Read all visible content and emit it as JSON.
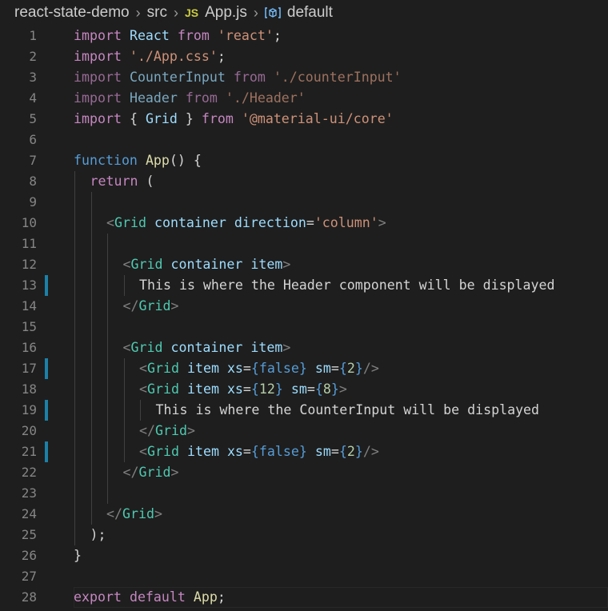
{
  "breadcrumb": {
    "folder": "react-state-demo",
    "subfolder": "src",
    "file_badge": "JS",
    "file": "App.js",
    "symbol": "default"
  },
  "lines": [
    {
      "n": "1",
      "indent": 0,
      "mark": false,
      "tokens": [
        [
          "kc",
          "import"
        ],
        [
          "txt",
          " "
        ],
        [
          "attr",
          "React"
        ],
        [
          "txt",
          " "
        ],
        [
          "kc",
          "from"
        ],
        [
          "txt",
          " "
        ],
        [
          "str",
          "'react'"
        ],
        [
          "txt",
          ";"
        ]
      ]
    },
    {
      "n": "2",
      "indent": 0,
      "mark": false,
      "tokens": [
        [
          "kc",
          "import"
        ],
        [
          "txt",
          " "
        ],
        [
          "str",
          "'./App.css'"
        ],
        [
          "txt",
          ";"
        ]
      ]
    },
    {
      "n": "3",
      "indent": 0,
      "mark": false,
      "dim": true,
      "tokens": [
        [
          "kc",
          "import"
        ],
        [
          "txt",
          " "
        ],
        [
          "attr",
          "CounterInput"
        ],
        [
          "txt",
          " "
        ],
        [
          "kc",
          "from"
        ],
        [
          "txt",
          " "
        ],
        [
          "str",
          "'./counterInput'"
        ]
      ]
    },
    {
      "n": "4",
      "indent": 0,
      "mark": false,
      "dim": true,
      "tokens": [
        [
          "kc",
          "import"
        ],
        [
          "txt",
          " "
        ],
        [
          "attr",
          "Header"
        ],
        [
          "txt",
          " "
        ],
        [
          "kc",
          "from"
        ],
        [
          "txt",
          " "
        ],
        [
          "str",
          "'./Header'"
        ]
      ]
    },
    {
      "n": "5",
      "indent": 0,
      "mark": false,
      "tokens": [
        [
          "kc",
          "import"
        ],
        [
          "txt",
          " { "
        ],
        [
          "attr",
          "Grid"
        ],
        [
          "txt",
          " } "
        ],
        [
          "kc",
          "from"
        ],
        [
          "txt",
          " "
        ],
        [
          "str",
          "'@material-ui/core'"
        ]
      ]
    },
    {
      "n": "6",
      "indent": 0,
      "mark": false,
      "tokens": []
    },
    {
      "n": "7",
      "indent": 0,
      "mark": false,
      "tokens": [
        [
          "kw",
          "function"
        ],
        [
          "txt",
          " "
        ],
        [
          "fn",
          "App"
        ],
        [
          "txt",
          "() {"
        ]
      ]
    },
    {
      "n": "8",
      "indent": 1,
      "mark": false,
      "tokens": [
        [
          "kc",
          "return"
        ],
        [
          "txt",
          " ("
        ]
      ]
    },
    {
      "n": "9",
      "indent": 2,
      "mark": false,
      "tokens": []
    },
    {
      "n": "10",
      "indent": 2,
      "mark": false,
      "tokens": [
        [
          "tag",
          "<"
        ],
        [
          "type",
          "Grid"
        ],
        [
          "txt",
          " "
        ],
        [
          "attr",
          "container"
        ],
        [
          "txt",
          " "
        ],
        [
          "attr",
          "direction"
        ],
        [
          "txt",
          "="
        ],
        [
          "str",
          "'column'"
        ],
        [
          "tag",
          ">"
        ]
      ]
    },
    {
      "n": "11",
      "indent": 3,
      "mark": false,
      "tokens": []
    },
    {
      "n": "12",
      "indent": 3,
      "mark": false,
      "tokens": [
        [
          "tag",
          "<"
        ],
        [
          "type",
          "Grid"
        ],
        [
          "txt",
          " "
        ],
        [
          "attr",
          "container"
        ],
        [
          "txt",
          " "
        ],
        [
          "attr",
          "item"
        ],
        [
          "tag",
          ">"
        ]
      ]
    },
    {
      "n": "13",
      "indent": 4,
      "mark": true,
      "tokens": [
        [
          "txt",
          "This is where the Header component will be displayed"
        ]
      ]
    },
    {
      "n": "14",
      "indent": 3,
      "mark": false,
      "tokens": [
        [
          "tag",
          "</"
        ],
        [
          "type",
          "Grid"
        ],
        [
          "tag",
          ">"
        ]
      ]
    },
    {
      "n": "15",
      "indent": 3,
      "mark": false,
      "tokens": []
    },
    {
      "n": "16",
      "indent": 3,
      "mark": false,
      "tokens": [
        [
          "tag",
          "<"
        ],
        [
          "type",
          "Grid"
        ],
        [
          "txt",
          " "
        ],
        [
          "attr",
          "container"
        ],
        [
          "txt",
          " "
        ],
        [
          "attr",
          "item"
        ],
        [
          "tag",
          ">"
        ]
      ]
    },
    {
      "n": "17",
      "indent": 4,
      "mark": true,
      "tokens": [
        [
          "tag",
          "<"
        ],
        [
          "type",
          "Grid"
        ],
        [
          "txt",
          " "
        ],
        [
          "attr",
          "item"
        ],
        [
          "txt",
          " "
        ],
        [
          "attr",
          "xs"
        ],
        [
          "txt",
          "="
        ],
        [
          "kw",
          "{"
        ],
        [
          "kw",
          "false"
        ],
        [
          "kw",
          "}"
        ],
        [
          "txt",
          " "
        ],
        [
          "attr",
          "sm"
        ],
        [
          "txt",
          "="
        ],
        [
          "kw",
          "{"
        ],
        [
          "num",
          "2"
        ],
        [
          "kw",
          "}"
        ],
        [
          "tag",
          "/>"
        ]
      ]
    },
    {
      "n": "18",
      "indent": 4,
      "mark": false,
      "tokens": [
        [
          "tag",
          "<"
        ],
        [
          "type",
          "Grid"
        ],
        [
          "txt",
          " "
        ],
        [
          "attr",
          "item"
        ],
        [
          "txt",
          " "
        ],
        [
          "attr",
          "xs"
        ],
        [
          "txt",
          "="
        ],
        [
          "kw",
          "{"
        ],
        [
          "num",
          "12"
        ],
        [
          "kw",
          "}"
        ],
        [
          "txt",
          " "
        ],
        [
          "attr",
          "sm"
        ],
        [
          "txt",
          "="
        ],
        [
          "kw",
          "{"
        ],
        [
          "num",
          "8"
        ],
        [
          "kw",
          "}"
        ],
        [
          "tag",
          ">"
        ]
      ]
    },
    {
      "n": "19",
      "indent": 5,
      "mark": true,
      "tokens": [
        [
          "txt",
          "This is where the CounterInput will be displayed"
        ]
      ]
    },
    {
      "n": "20",
      "indent": 4,
      "mark": false,
      "tokens": [
        [
          "tag",
          "</"
        ],
        [
          "type",
          "Grid"
        ],
        [
          "tag",
          ">"
        ]
      ]
    },
    {
      "n": "21",
      "indent": 4,
      "mark": true,
      "tokens": [
        [
          "tag",
          "<"
        ],
        [
          "type",
          "Grid"
        ],
        [
          "txt",
          " "
        ],
        [
          "attr",
          "item"
        ],
        [
          "txt",
          " "
        ],
        [
          "attr",
          "xs"
        ],
        [
          "txt",
          "="
        ],
        [
          "kw",
          "{"
        ],
        [
          "kw",
          "false"
        ],
        [
          "kw",
          "}"
        ],
        [
          "txt",
          " "
        ],
        [
          "attr",
          "sm"
        ],
        [
          "txt",
          "="
        ],
        [
          "kw",
          "{"
        ],
        [
          "num",
          "2"
        ],
        [
          "kw",
          "}"
        ],
        [
          "tag",
          "/>"
        ]
      ]
    },
    {
      "n": "22",
      "indent": 3,
      "mark": false,
      "tokens": [
        [
          "tag",
          "</"
        ],
        [
          "type",
          "Grid"
        ],
        [
          "tag",
          ">"
        ]
      ]
    },
    {
      "n": "23",
      "indent": 3,
      "mark": false,
      "tokens": []
    },
    {
      "n": "24",
      "indent": 2,
      "mark": false,
      "tokens": [
        [
          "tag",
          "</"
        ],
        [
          "type",
          "Grid"
        ],
        [
          "tag",
          ">"
        ]
      ]
    },
    {
      "n": "25",
      "indent": 1,
      "mark": false,
      "tokens": [
        [
          "txt",
          ");"
        ]
      ]
    },
    {
      "n": "26",
      "indent": 0,
      "mark": false,
      "tokens": [
        [
          "txt",
          "}"
        ]
      ]
    },
    {
      "n": "27",
      "indent": 0,
      "mark": false,
      "tokens": []
    },
    {
      "n": "28",
      "indent": 0,
      "mark": false,
      "current": true,
      "tokens": [
        [
          "kc",
          "export"
        ],
        [
          "txt",
          " "
        ],
        [
          "kc",
          "default"
        ],
        [
          "txt",
          " "
        ],
        [
          "fn",
          "App"
        ],
        [
          "txt",
          ";"
        ]
      ]
    }
  ],
  "guides": [
    "2",
    "3",
    "4",
    "4",
    "5"
  ],
  "colors": {
    "background": "#1e1e1e",
    "keyword_control": "#c586c0",
    "keyword": "#569cd6",
    "string": "#ce9178",
    "component": "#4ec9b0",
    "attribute": "#9cdcfe",
    "function": "#dcdcaa",
    "number": "#b5cea8",
    "modified_marker": "#1b81a8"
  }
}
